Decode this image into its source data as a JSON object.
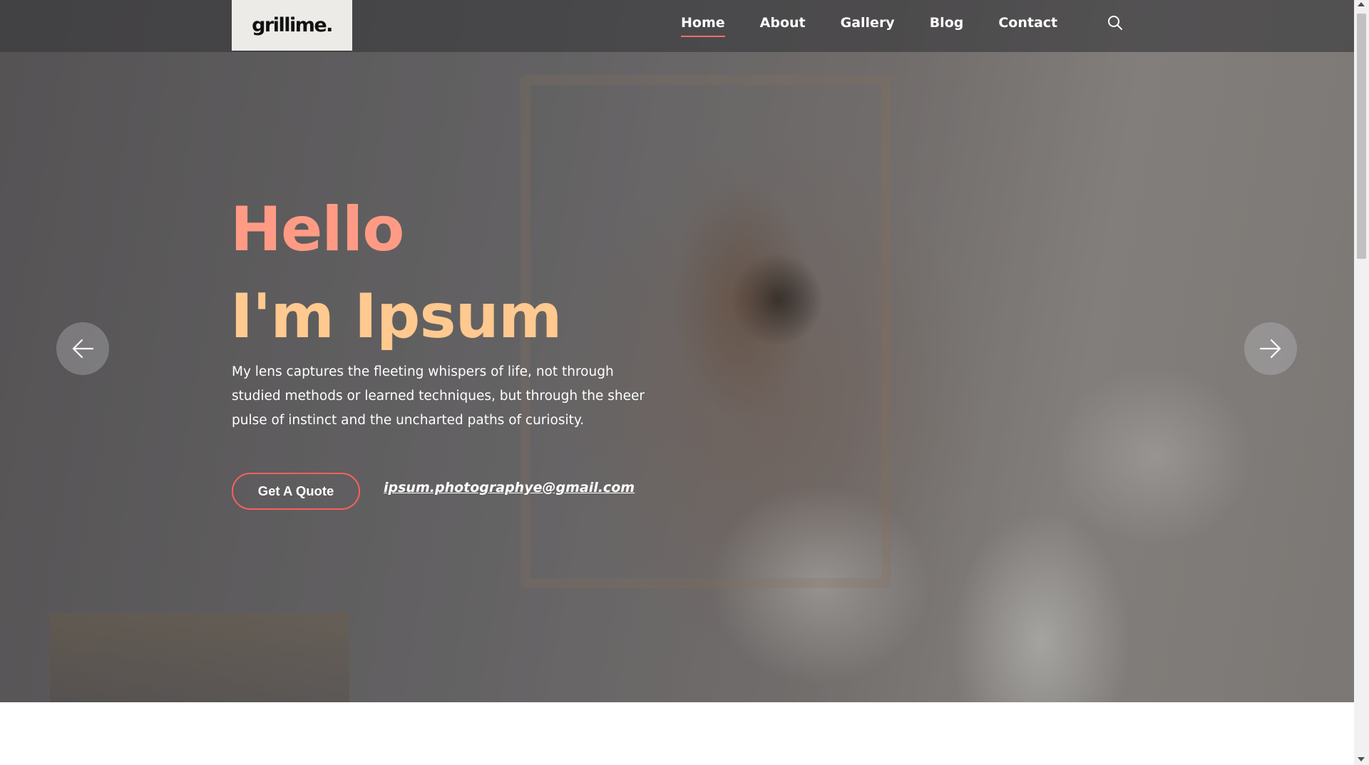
{
  "brand": {
    "logo_text": "grillime."
  },
  "nav": {
    "items": [
      {
        "label": "Home",
        "active": true
      },
      {
        "label": "About",
        "active": false
      },
      {
        "label": "Gallery",
        "active": false
      },
      {
        "label": "Blog",
        "active": false
      },
      {
        "label": "Contact",
        "active": false
      }
    ],
    "search_icon": "search-icon"
  },
  "hero": {
    "line1": "Hello",
    "line2": "I'm Ipsum",
    "description": "My lens captures the fleeting whispers of life, not through studied methods or learned techniques, but through the sheer pulse of instinct and the uncharted paths of curiosity.",
    "cta_label": "Get A Quote",
    "email": "ipsum.photographye@gmail.com",
    "prev_icon": "arrow-left-icon",
    "next_icon": "arrow-right-icon"
  },
  "colors": {
    "hello": "#ff9b84",
    "name": "#ffc98f",
    "accent": "#ff5f5f",
    "nav_active_underline": "#ff6d6d"
  }
}
